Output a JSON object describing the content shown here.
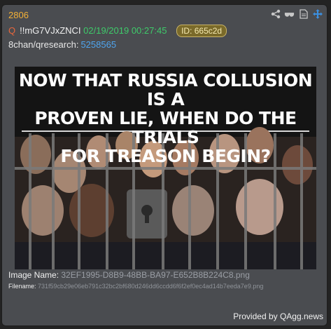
{
  "post": {
    "number": "2806",
    "q_glyph": "Q",
    "tripcode": "!!mG7VJxZNCI",
    "date": "02/19/2019 00:27:45",
    "id_label": "ID: 665c2d",
    "board": "8chan/qresearch:",
    "post_link": "5258565"
  },
  "icons": [
    "share-icon",
    "glasses-icon",
    "document-icon",
    "move-icon"
  ],
  "image": {
    "headline_1": "NOW THAT RUSSIA COLLUSION IS A",
    "headline_2": "PROVEN LIE, WHEN DO THE TRIALS",
    "headline_3": "FOR TREASON BEGIN?"
  },
  "meta": {
    "image_name_label": "Image Name:",
    "image_name": "32EF1995-D8B9-48BB-BA97-E652B8B224C8.png",
    "filename_label": "Filename:",
    "filename": "731f59cb29e06eb791c32bc2bf680d246dd6ccdd6f6f2ef0ec4ad14b7eeda7e9.png"
  },
  "footer": {
    "provided_by": "Provided by QAgg.news"
  }
}
